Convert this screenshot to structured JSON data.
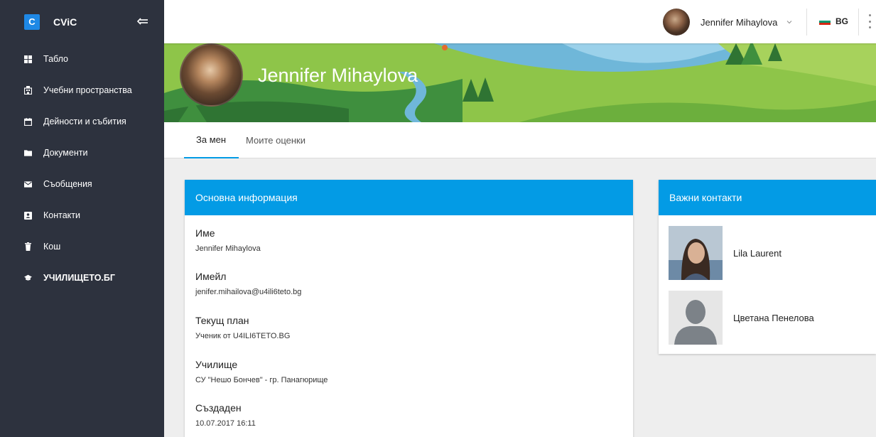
{
  "app": {
    "logo_letter": "C",
    "title": "CViC"
  },
  "sidebar": {
    "items": [
      {
        "label": "Табло",
        "icon": "dashboard-icon"
      },
      {
        "label": "Учебни пространства",
        "icon": "classroom-icon"
      },
      {
        "label": "Дейности и събития",
        "icon": "calendar-icon"
      },
      {
        "label": "Документи",
        "icon": "folder-icon"
      },
      {
        "label": "Съобщения",
        "icon": "mail-icon"
      },
      {
        "label": "Контакти",
        "icon": "contacts-icon"
      },
      {
        "label": "Кош",
        "icon": "trash-icon"
      },
      {
        "label": "УЧИЛИЩЕТО.БГ",
        "icon": "graduation-cap-icon"
      }
    ]
  },
  "topbar": {
    "user_name": "Jennifer Mihaylova",
    "language": "BG"
  },
  "profile": {
    "name": "Jennifer Mihaylova"
  },
  "tabs": {
    "about": "За мен",
    "grades": "Моите оценки"
  },
  "basic_info": {
    "title": "Основна информация",
    "name_label": "Име",
    "name_value": "Jennifer Mihaylova",
    "email_label": "Имейл",
    "email_value": "jenifer.mihailova@u4ili6teto.bg",
    "plan_label": "Текущ план",
    "plan_value": "Ученик от U4ILI6TETO.BG",
    "school_label": "Училище",
    "school_value": "СУ \"Нешо Бончев\" - гр. Панагюрище",
    "created_label": "Създаден",
    "created_value": "10.07.2017 16:11"
  },
  "contacts": {
    "title": "Важни контакти",
    "items": [
      {
        "name": "Lila Laurent"
      },
      {
        "name": "Цветана Пенелова"
      }
    ]
  },
  "colors": {
    "sidebar_bg": "#2d323e",
    "accent": "#039be5",
    "logo": "#1e88e5"
  }
}
